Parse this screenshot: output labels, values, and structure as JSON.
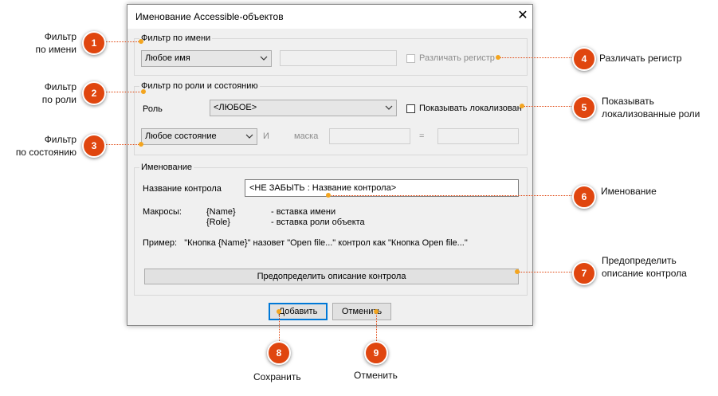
{
  "dialog": {
    "title": "Именование Accessible-объектов",
    "close_glyph": "✕"
  },
  "name_filter": {
    "legend": "Фильтр по имени",
    "combo_value": "Любое имя",
    "text_value": "",
    "case_label": "Различать регистр"
  },
  "role_filter": {
    "legend": "Фильтр по роли и состоянию",
    "role_label": "Роль",
    "role_value": "<ЛЮБОЕ>",
    "localized_label": "Показывать локализован",
    "state_value": "Любое состояние",
    "and_label": "И",
    "mask_label": "маска",
    "equals_label": "="
  },
  "naming": {
    "legend": "Именование",
    "control_name_label": "Название контрола",
    "control_name_value": "<НЕ ЗАБЫТЬ : Название контрола>",
    "macros_label": "Макросы:",
    "macro1_name": "{Name}",
    "macro1_desc": "- вставка имени",
    "macro2_name": "{Role}",
    "macro2_desc": "- вставка роли объекта",
    "example": "Пример:   \"Кнопка {Name}\" назовет \"Open file...\" контрол как \"Кнопка Open file...\"",
    "predefine_button": "Предопределить описание контрола"
  },
  "footer": {
    "add_button": "Добавить",
    "cancel_button": "Отменить"
  },
  "callouts": [
    {
      "num": "1",
      "text1": "Фильтр",
      "text2": "по имени"
    },
    {
      "num": "2",
      "text1": "Фильтр",
      "text2": "по роли"
    },
    {
      "num": "3",
      "text1": "Фильтр",
      "text2": "по состоянию"
    },
    {
      "num": "4",
      "text1": "Различать регистр",
      "text2": ""
    },
    {
      "num": "5",
      "text1": "Показывать",
      "text2": "локализованные роли"
    },
    {
      "num": "6",
      "text1": "Именование",
      "text2": ""
    },
    {
      "num": "7",
      "text1": "Предопределить",
      "text2": "описание контрола"
    },
    {
      "num": "8",
      "text1": "Сохранить",
      "text2": ""
    },
    {
      "num": "9",
      "text1": "Отменить",
      "text2": ""
    }
  ],
  "colors": {
    "badge": "#e0460f",
    "dot": "#f3a51f",
    "accent": "#0078d7"
  }
}
